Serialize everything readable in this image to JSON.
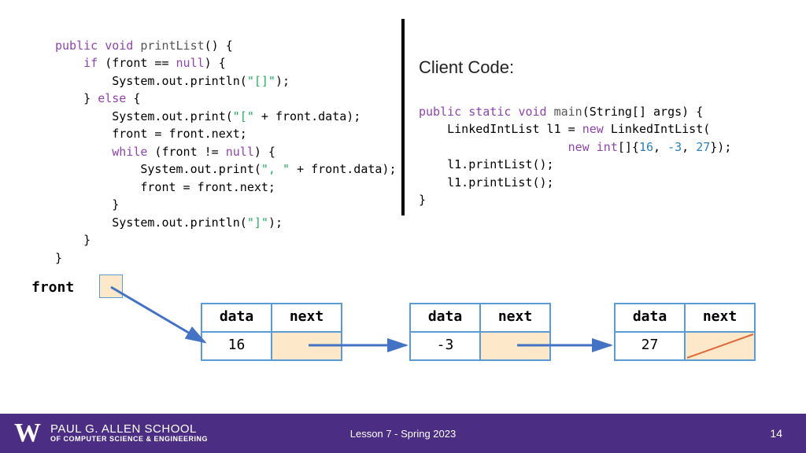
{
  "code_left": {
    "l1_kw1": "public",
    "l1_kw2": "void",
    "l1_fn": "printList",
    "l1_p": "() {",
    "l2_ind": "    ",
    "l2_kw": "if",
    "l2_rest": " (front == ",
    "l2_null": "null",
    "l2_end": ") {",
    "l3_ind": "        ",
    "l3a": "System.out.println(",
    "l3s": "\"[]\"",
    "l3b": ");",
    "l4_ind": "    ",
    "l4a": "} ",
    "l4_kw": "else",
    "l4b": " {",
    "l5_ind": "        ",
    "l5a": "System.out.print(",
    "l5s": "\"[\"",
    "l5b": " + front.data);",
    "l6_ind": "        ",
    "l6": "front = front.next;",
    "l7_ind": "        ",
    "l7_kw": "while",
    "l7a": " (front != ",
    "l7_null": "null",
    "l7b": ") {",
    "l8_ind": "            ",
    "l8a": "System.out.print(",
    "l8s": "\", \"",
    "l8b": " + front.data);",
    "l9_ind": "            ",
    "l9": "front = front.next;",
    "l10_ind": "        ",
    "l10": "}",
    "l11_ind": "        ",
    "l11a": "System.out.println(",
    "l11s": "\"]\"",
    "l11b": ");",
    "l12_ind": "    ",
    "l12": "}",
    "l13": "}"
  },
  "client": {
    "title": "Client Code:",
    "l1_kw1": "public",
    "l1_kw2": "static",
    "l1_kw3": "void",
    "l1_fn": "main",
    "l1_p": "(String[] args) {",
    "l2_ind": "    ",
    "l2a": "LinkedIntList l1 = ",
    "l2_kw": "new",
    "l2b": " LinkedIntList(",
    "l3_ind": "                     ",
    "l3_kw": "new",
    "l3a": " ",
    "l3_type": "int",
    "l3b": "[]{",
    "l3_n1": "16",
    "l3c": ", ",
    "l3_n2": "-3",
    "l3d": ", ",
    "l3_n3": "27",
    "l3e": "});",
    "l4_ind": "    ",
    "l4": "l1.printList();",
    "l5_ind": "    ",
    "l5": "l1.printList();",
    "l6": "}"
  },
  "diagram": {
    "front_label": "front",
    "headers": {
      "data": "data",
      "next": "next"
    },
    "nodes": [
      {
        "value": "16"
      },
      {
        "value": "-3"
      },
      {
        "value": "27"
      }
    ]
  },
  "footer": {
    "w": "W",
    "school_line1": "PAUL G. ALLEN SCHOOL",
    "school_line2": "OF COMPUTER SCIENCE & ENGINEERING",
    "lesson": "Lesson 7 - Spring 2023",
    "page": "14"
  }
}
